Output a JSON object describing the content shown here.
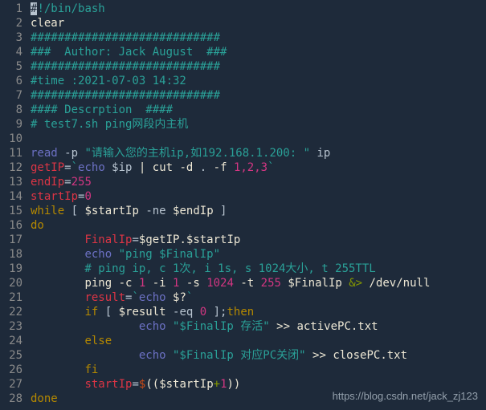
{
  "lines": {
    "l1_shebang_h": "#",
    "l1_shebang_rest": "!/bin/bash",
    "l2": "clear",
    "l3": "############################",
    "l4": "###  Author: Jack August  ###",
    "l5": "############################",
    "l6": "#time :2021-07-03 14:32",
    "l7": "############################",
    "l8": "#### Descrption  ####",
    "l9": "# test7.sh ping网段内主机",
    "l11_read": "read",
    "l11_p": " -p ",
    "l11_str": "\"请输入您的主机ip,如192.168.1.200: \"",
    "l11_var": " ip",
    "l12_var": "getIP",
    "l12_eq": "=",
    "l12_tick": "`",
    "l12_echo": "echo",
    "l12_ip": " $ip ",
    "l12_pipe": "| ",
    "l12_cut": "cut ",
    "l12_d": "-d",
    "l12_dot": " . ",
    "l12_f": "-f ",
    "l12_nums": "1,2,3",
    "l13_var": "endIp",
    "l13_eq": "=",
    "l13_val": "255",
    "l14_var": "startIp",
    "l14_eq": "=",
    "l14_val": "0",
    "l15_while": "while",
    "l15_b1": " [ ",
    "l15_v1": "$startIp",
    "l15_ne": " -ne ",
    "l15_v2": "$endIp",
    "l15_b2": " ]",
    "l16": "do",
    "l17_pad": "        ",
    "l17_var": "FinalIp",
    "l17_eq": "=",
    "l17_val": "$getIP.$startIp",
    "l18_pad": "        ",
    "l18_echo": "echo",
    "l18_str": " \"ping $FinalIp\"",
    "l19": "        # ping ip, c 1次, i 1s, s 1024大小, t 255TTL",
    "l20_pad": "        ",
    "l20_ping": "ping ",
    "l20_c": "-c ",
    "l20_c1": "1",
    "l20_i": " -i ",
    "l20_i1": "1",
    "l20_s": " -s ",
    "l20_s1": "1024",
    "l20_t": " -t ",
    "l20_t1": "255",
    "l20_fip": " $FinalIp ",
    "l20_amp": "&>",
    "l20_dev": " /dev/null",
    "l21_pad": "        ",
    "l21_var": "result",
    "l21_eq": "=",
    "l21_tick": "`",
    "l21_echo": "echo",
    "l21_q": " $?",
    "l22_pad": "        ",
    "l22_if": "if",
    "l22_b1": " [ ",
    "l22_r": "$result",
    "l22_eq": " -eq ",
    "l22_0": "0",
    "l22_b2": " ];",
    "l22_then": "then",
    "l23_pad": "                ",
    "l23_echo": "echo",
    "l23_str": " \"$FinalIp 存活\"",
    "l23_redir": " >> ",
    "l23_file": "activePC.txt",
    "l24_pad": "        ",
    "l24_else": "else",
    "l25_pad": "                ",
    "l25_echo": "echo",
    "l25_str": " \"$FinalIp 对应PC关闭\"",
    "l25_redir": " >> ",
    "l25_file": "closePC.txt",
    "l26_pad": "        ",
    "l26_fi": "fi",
    "l27_pad": "        ",
    "l27_var": "startIp",
    "l27_eq": "=",
    "l27_d": "$",
    "l27_p1": "((",
    "l27_v": "$startIp",
    "l27_plus": "+",
    "l27_1": "1",
    "l27_p2": "))",
    "l28": "done"
  },
  "line_numbers": [
    "1",
    "2",
    "3",
    "4",
    "5",
    "6",
    "7",
    "8",
    "9",
    "10",
    "11",
    "12",
    "13",
    "14",
    "15",
    "16",
    "17",
    "18",
    "19",
    "20",
    "21",
    "22",
    "23",
    "24",
    "25",
    "26",
    "27",
    "28"
  ],
  "watermark": "https://blog.csdn.net/jack_zj123"
}
